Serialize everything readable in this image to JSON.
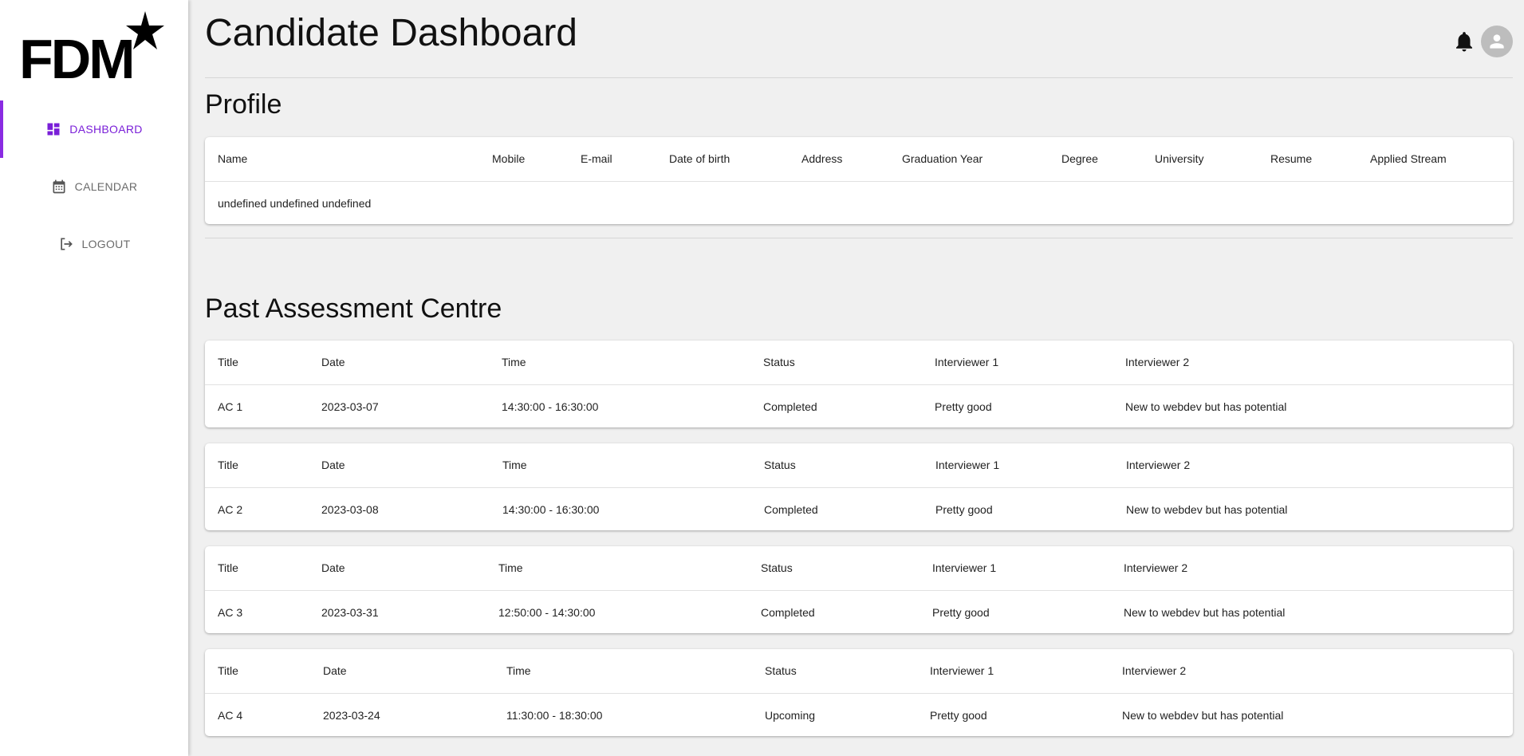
{
  "app": {
    "logo_text": "FDM",
    "brand_color": "#8a2be2",
    "logo_color": "#000000"
  },
  "sidebar": {
    "items": [
      {
        "label": "DASHBOARD",
        "icon": "dashboard-icon",
        "active": true
      },
      {
        "label": "CALENDAR",
        "icon": "calendar-icon",
        "active": false
      },
      {
        "label": "LOGOUT",
        "icon": "logout-icon",
        "active": false
      }
    ]
  },
  "header": {
    "title": "Candidate Dashboard",
    "icons": [
      "bell-icon",
      "avatar-icon"
    ]
  },
  "profile": {
    "title": "Profile",
    "columns": [
      "Name",
      "Mobile",
      "E-mail",
      "Date of birth",
      "Address",
      "Graduation Year",
      "Degree",
      "University",
      "Resume",
      "Applied Stream"
    ],
    "row": [
      "undefined undefined undefined",
      "",
      "",
      "",
      "",
      "",
      "",
      "",
      "",
      ""
    ]
  },
  "assessments": {
    "title": "Past Assessment Centre",
    "columns": [
      "Title",
      "Date",
      "Time",
      "Status",
      "Interviewer 1",
      "Interviewer 2"
    ],
    "rows": [
      [
        "AC 1",
        "2023-03-07",
        "14:30:00 - 16:30:00",
        "Completed",
        "Pretty good",
        "New to webdev but has potential"
      ],
      [
        "AC 2",
        "2023-03-08",
        "14:30:00 - 16:30:00",
        "Completed",
        "Pretty good",
        "New to webdev but has potential"
      ],
      [
        "AC 3",
        "2023-03-31",
        "12:50:00 - 14:30:00",
        "Completed",
        "Pretty good",
        "New to webdev but has potential"
      ],
      [
        "AC 4",
        "2023-03-24",
        "11:30:00 - 18:30:00",
        "Upcoming",
        "Pretty good",
        "New to webdev but has potential"
      ]
    ]
  }
}
